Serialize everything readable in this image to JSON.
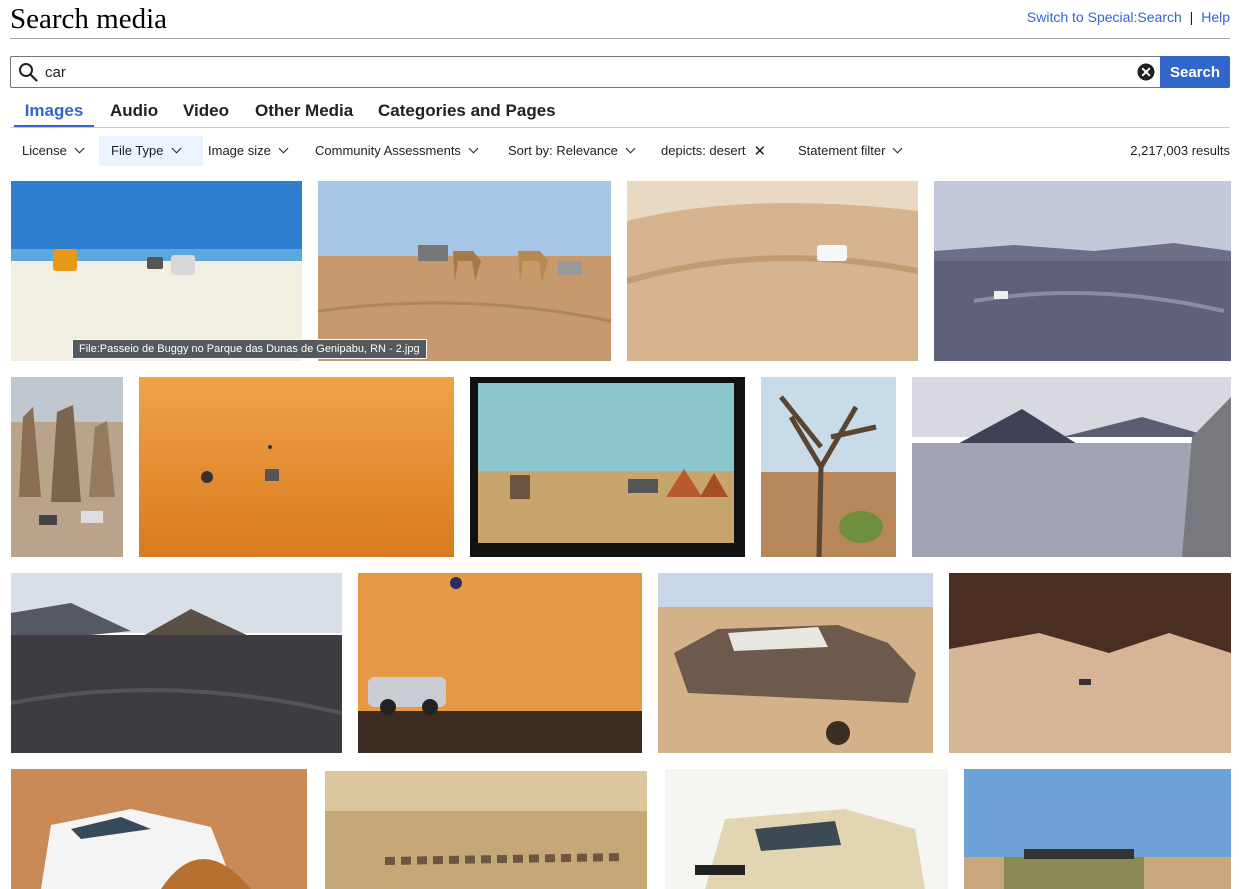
{
  "header": {
    "title": "Search media",
    "switch_link": "Switch to Special:Search",
    "separator": "|",
    "help_link": "Help"
  },
  "search": {
    "value": "car",
    "button_label": "Search"
  },
  "tabs": [
    {
      "label": "Images",
      "active": true
    },
    {
      "label": "Audio",
      "active": false
    },
    {
      "label": "Video",
      "active": false
    },
    {
      "label": "Other Media",
      "active": false
    },
    {
      "label": "Categories and Pages",
      "active": false
    }
  ],
  "filters": [
    {
      "label": "License",
      "icon": "chevron-down-icon"
    },
    {
      "label": "File Type",
      "icon": "chevron-down-icon"
    },
    {
      "label": "Image size",
      "icon": "chevron-down-icon"
    },
    {
      "label": "Community Assessments",
      "icon": "chevron-down-icon"
    },
    {
      "label": "Sort by: Relevance",
      "icon": "chevron-down-icon"
    },
    {
      "label": "depicts: desert",
      "icon": "close-icon"
    },
    {
      "label": "Statement filter",
      "icon": "chevron-down-icon"
    }
  ],
  "results_count": "2,217,003 results",
  "tooltip": "File:Passeio de Buggy no Parque das Dunas de Genipabu, RN - 2.jpg",
  "colors": {
    "accent": "#3366cc",
    "text": "#202122",
    "border": "#a2a9b1"
  }
}
